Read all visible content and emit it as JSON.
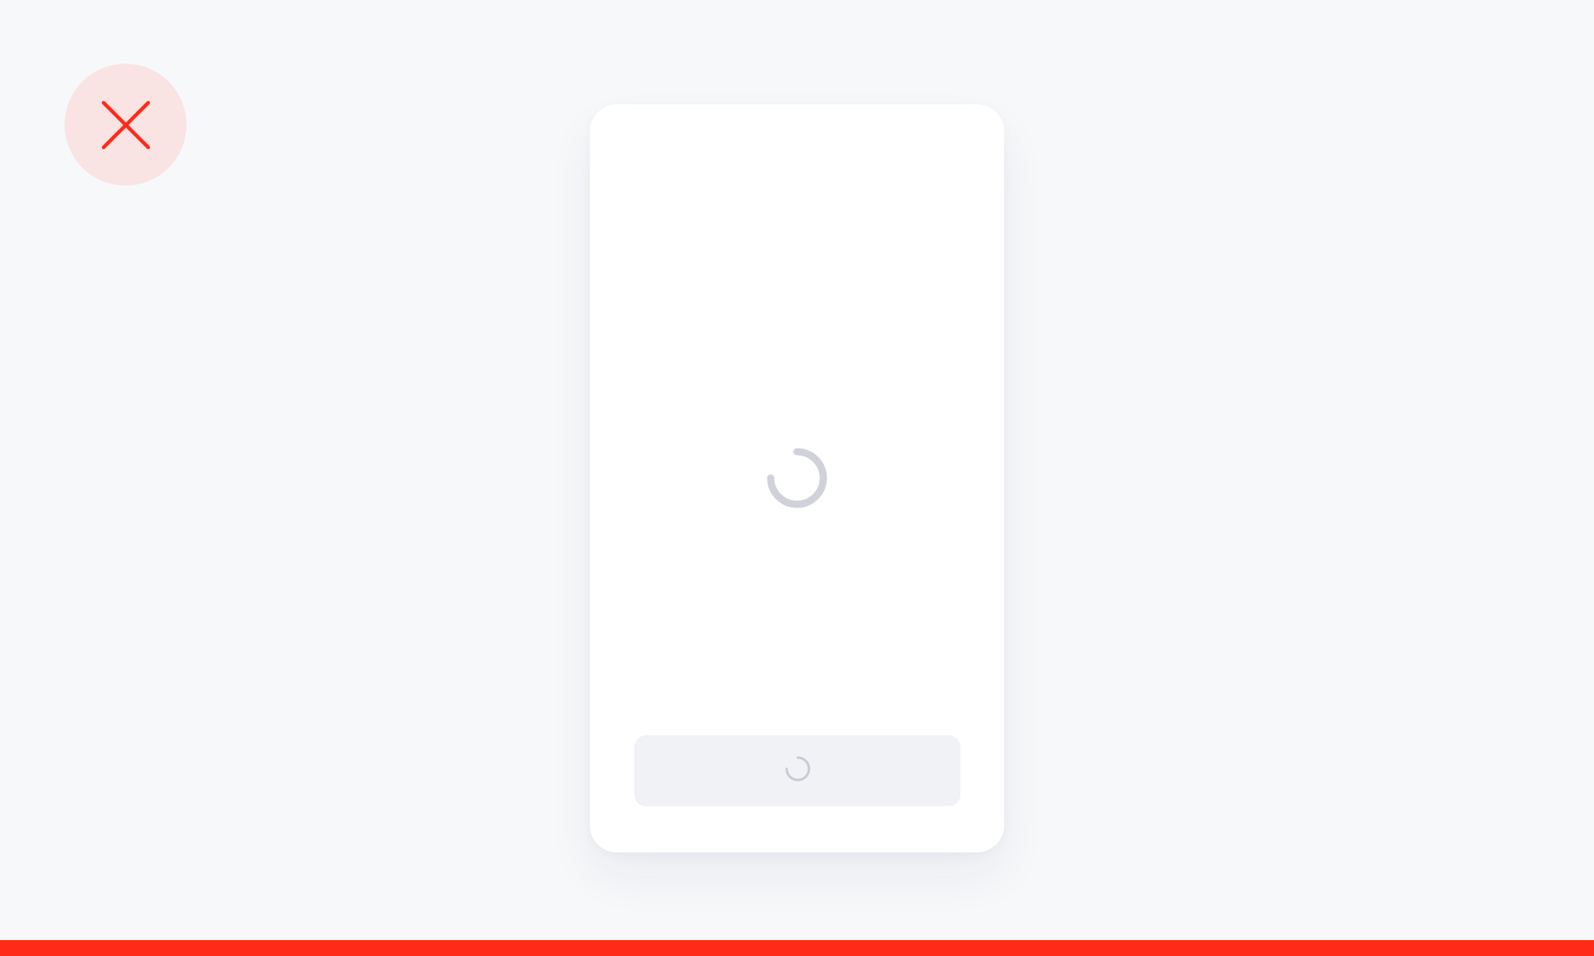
{
  "close_button": {
    "icon": "close-icon",
    "icon_color": "#ff2a17",
    "bg_color": "#f9e3e3"
  },
  "card": {
    "state": "loading",
    "spinner_icon": "spinner-icon",
    "spinner_color": "#d0d1d9",
    "button": {
      "label": "",
      "state": "loading",
      "spinner_icon": "spinner-icon"
    }
  },
  "progress": {
    "value": 1.0,
    "color": "#ff2a17"
  }
}
